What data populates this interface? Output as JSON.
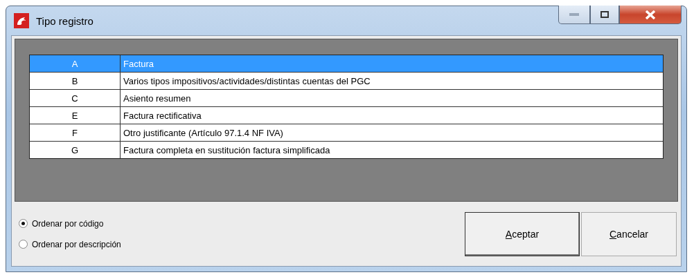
{
  "window": {
    "title": "Tipo registro"
  },
  "table": {
    "rows": [
      {
        "code": "A",
        "description": "Factura",
        "selected": true
      },
      {
        "code": "B",
        "description": "Varios tipos impositivos/actividades/distintas cuentas del PGC",
        "selected": false
      },
      {
        "code": "C",
        "description": "Asiento resumen",
        "selected": false
      },
      {
        "code": "E",
        "description": "Factura rectificativa",
        "selected": false
      },
      {
        "code": "F",
        "description": "Otro justificante (Artículo 97.1.4 NF IVA)",
        "selected": false
      },
      {
        "code": "G",
        "description": "Factura completa en sustitución factura simplificada",
        "selected": false
      }
    ]
  },
  "sort_options": [
    {
      "label": "Ordenar por código",
      "selected": true
    },
    {
      "label": "Ordenar por descripción",
      "selected": false
    }
  ],
  "buttons": [
    {
      "accel": "A",
      "rest": "ceptar",
      "default": true
    },
    {
      "accel": "C",
      "rest": "ancelar",
      "default": false
    }
  ]
}
